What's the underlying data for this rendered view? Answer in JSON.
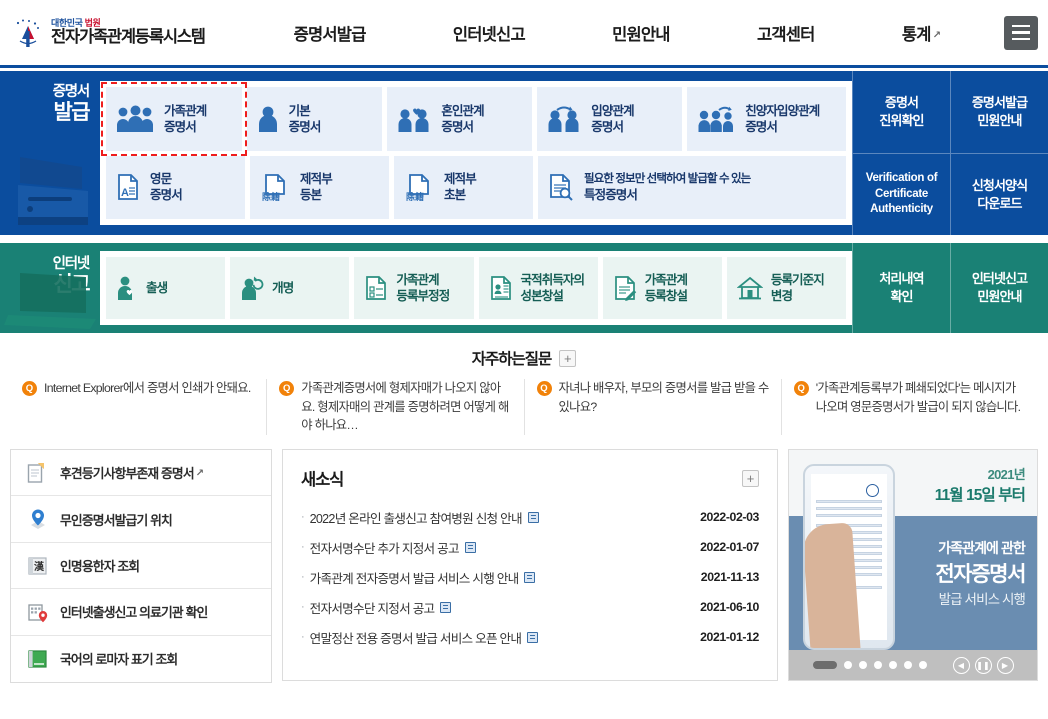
{
  "header": {
    "logo_sub_blue": "대한민국",
    "logo_sub_red": "법원",
    "logo_main": "전자가족관계등록시스템",
    "nav": [
      {
        "label": "증명서발급",
        "external": false
      },
      {
        "label": "인터넷신고",
        "external": false
      },
      {
        "label": "민원안내",
        "external": false
      },
      {
        "label": "고객센터",
        "external": false
      },
      {
        "label": "통계",
        "external": true
      }
    ],
    "ext_mark": "↗",
    "menu_icon": "hamburger-icon"
  },
  "cert_block": {
    "label_small": "증명서",
    "label_big": "발급",
    "accent_color": "#0b4d9e",
    "selected_index": 0,
    "row1": [
      {
        "label_line1": "가족관계",
        "label_line2": "증명서",
        "icon": "family-group-icon",
        "selected": true
      },
      {
        "label_line1": "기본",
        "label_line2": "증명서",
        "icon": "person-icon",
        "selected": false
      },
      {
        "label_line1": "혼인관계",
        "label_line2": "증명서",
        "icon": "couple-heart-icon",
        "selected": false
      },
      {
        "label_line1": "입양관계",
        "label_line2": "증명서",
        "icon": "couple-arrow-icon",
        "selected": false
      },
      {
        "label_line1": "친양자입양관계",
        "label_line2": "증명서",
        "icon": "family-arrow-icon",
        "selected": false
      }
    ],
    "row2": [
      {
        "label_line1": "영문",
        "label_line2": "증명서",
        "icon": "doc-a-icon"
      },
      {
        "label_line1": "제적부",
        "label_line2": "등본",
        "icon": "doc-jejeok-icon"
      },
      {
        "label_line1": "제적부",
        "label_line2": "초본",
        "icon": "doc-jejeok2-icon"
      },
      {
        "label_line1": "필요한 정보만 선택하여 발급할 수 있는",
        "label_line2": "특정증명서",
        "icon": "doc-search-icon"
      }
    ],
    "side": [
      {
        "line1": "증명서",
        "line2": "진위확인",
        "english": false
      },
      {
        "line1": "증명서발급",
        "line2": "민원안내",
        "english": false
      },
      {
        "line1": "Verification of",
        "line2": "Certificate",
        "line3": "Authenticity",
        "english": true
      },
      {
        "line1": "신청서양식",
        "line2": "다운로드",
        "english": false
      }
    ]
  },
  "report_block": {
    "label_small": "인터넷",
    "label_big": "신고",
    "accent_color": "#1a8175",
    "items": [
      {
        "label_line1": "출생",
        "label_line2": "",
        "icon": "person-heart-icon"
      },
      {
        "label_line1": "개명",
        "label_line2": "",
        "icon": "person-refresh-icon"
      },
      {
        "label_line1": "가족관계",
        "label_line2": "등록부정정",
        "icon": "doc-check-icon"
      },
      {
        "label_line1": "국적취득자의",
        "label_line2": "성본창설",
        "icon": "doc-id-icon"
      },
      {
        "label_line1": "가족관계",
        "label_line2": "등록창설",
        "icon": "doc-pen-icon"
      },
      {
        "label_line1": "등록기준지",
        "label_line2": "변경",
        "icon": "house-icon"
      }
    ],
    "side": [
      {
        "line1": "처리내역",
        "line2": "확인"
      },
      {
        "line1": "인터넷신고",
        "line2": "민원안내"
      }
    ]
  },
  "faq": {
    "title": "자주하는질문",
    "more_label": "+",
    "badge_char": "Q",
    "badge_color": "#f1820a",
    "items": [
      "Internet Explorer에서 증명서 인쇄가 안돼요.",
      "가족관계증명서에 형제자매가 나오지 않아요. 형제자매의 관계를 증명하려면 어떻게 해야 하나요…",
      "자녀나 배우자, 부모의 증명서를 발급 받을 수 있나요?",
      "'가족관계등록부가 폐쇄되었다'는 메시지가 나오며 영문증명서가 발급이 되지 않습니다."
    ]
  },
  "quick_list": {
    "items": [
      {
        "label": "후견등기사항부존재 증명서",
        "icon": "doc-copy-icon",
        "external": true
      },
      {
        "label": "무인증명서발급기 위치",
        "icon": "map-pin-icon",
        "external": false
      },
      {
        "label": "인명용한자 조회",
        "icon": "hanja-book-icon",
        "external": false
      },
      {
        "label": "인터넷출생신고 의료기관 확인",
        "icon": "hospital-pin-icon",
        "external": false
      },
      {
        "label": "국어의 로마자 표기 조회",
        "icon": "green-book-icon",
        "external": false
      }
    ],
    "ext_mark": "↗"
  },
  "news": {
    "title": "새소식",
    "more_label": "+",
    "items": [
      {
        "title": "2022년 온라인 출생신고 참여병원 신청 안내",
        "date": "2022-02-03",
        "has_file": true
      },
      {
        "title": "전자서명수단 추가 지정서 공고",
        "date": "2022-01-07",
        "has_file": true
      },
      {
        "title": "가족관계 전자증명서 발급 서비스 시행 안내",
        "date": "2021-11-13",
        "has_file": true
      },
      {
        "title": "전자서명수단 지정서 공고",
        "date": "2021-06-10",
        "has_file": true
      },
      {
        "title": "연말정산 전용 증명서 발급 서비스 오픈 안내",
        "date": "2021-01-12",
        "has_file": true
      }
    ]
  },
  "promo": {
    "year": "2021년",
    "date": "11월 15일 부터",
    "line1": "가족관계에 관한",
    "line2": "전자증명서",
    "line3": "발급 서비스 시행",
    "total_slides": 7,
    "active_slide": 1,
    "prev_icon": "chevron-left-icon",
    "pause_icon": "pause-icon",
    "next_icon": "chevron-right-icon"
  }
}
